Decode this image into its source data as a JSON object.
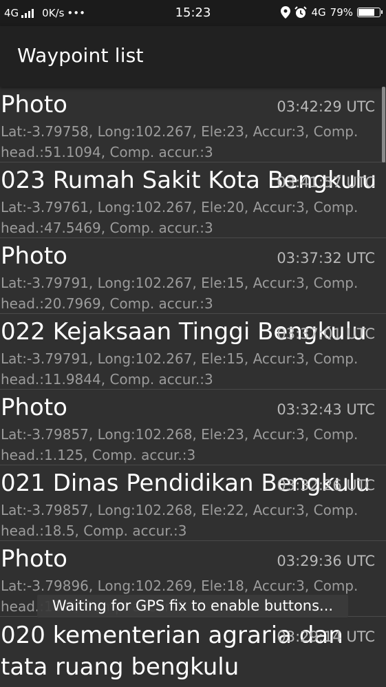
{
  "status_bar": {
    "network": "4G",
    "speed": "0K/s",
    "more": "•••",
    "time": "15:23",
    "network_right": "4G",
    "battery": "79%",
    "battery_level": 0.79,
    "icons": [
      "signal-icon",
      "location-icon",
      "alarm-icon",
      "battery-icon"
    ]
  },
  "app_bar": {
    "title": "Waypoint list"
  },
  "waypoints": [
    {
      "name": "Photo",
      "time": "03:42:29 UTC",
      "details": "Lat:-3.79758, Long:102.267, Ele:23, Accur:3, Comp. head.:51.1094, Comp. accur.:3"
    },
    {
      "name": "023 Rumah Sakit Kota Bengkulu",
      "time": "03:41:57 UTC",
      "details": "Lat:-3.79761, Long:102.267, Ele:20, Accur:3, Comp. head.:47.5469, Comp. accur.:3"
    },
    {
      "name": "Photo",
      "time": "03:37:32 UTC",
      "details": "Lat:-3.79791, Long:102.267, Ele:15, Accur:3, Comp. head.:20.7969, Comp. accur.:3"
    },
    {
      "name": "022 Kejaksaan Tinggi Bengkulu",
      "time": "03:37:01 UTC",
      "details": "Lat:-3.79791, Long:102.267, Ele:15, Accur:3, Comp. head.:11.9844, Comp. accur.:3"
    },
    {
      "name": "Photo",
      "time": "03:32:43 UTC",
      "details": "Lat:-3.79857, Long:102.268, Ele:23, Accur:3, Comp. head.:1.125, Comp. accur.:3"
    },
    {
      "name": "021 Dinas Pendidikan Bengkulu",
      "time": "03:32:26 UTC",
      "details": "Lat:-3.79857, Long:102.268, Ele:22, Accur:3, Comp. head.:18.5, Comp. accur.:3"
    },
    {
      "name": "Photo",
      "time": "03:29:36 UTC",
      "details": "Lat:-3.79896, Long:102.269, Ele:18, Accur:3, Comp. head.:16.0, Comp. accur.:3"
    },
    {
      "name": "020 kementerian agraria dan tata ruang bengkulu",
      "time": "03:29:14 UTC",
      "details": ""
    }
  ],
  "toast": {
    "message": "Waiting for GPS fix to enable buttons..."
  }
}
